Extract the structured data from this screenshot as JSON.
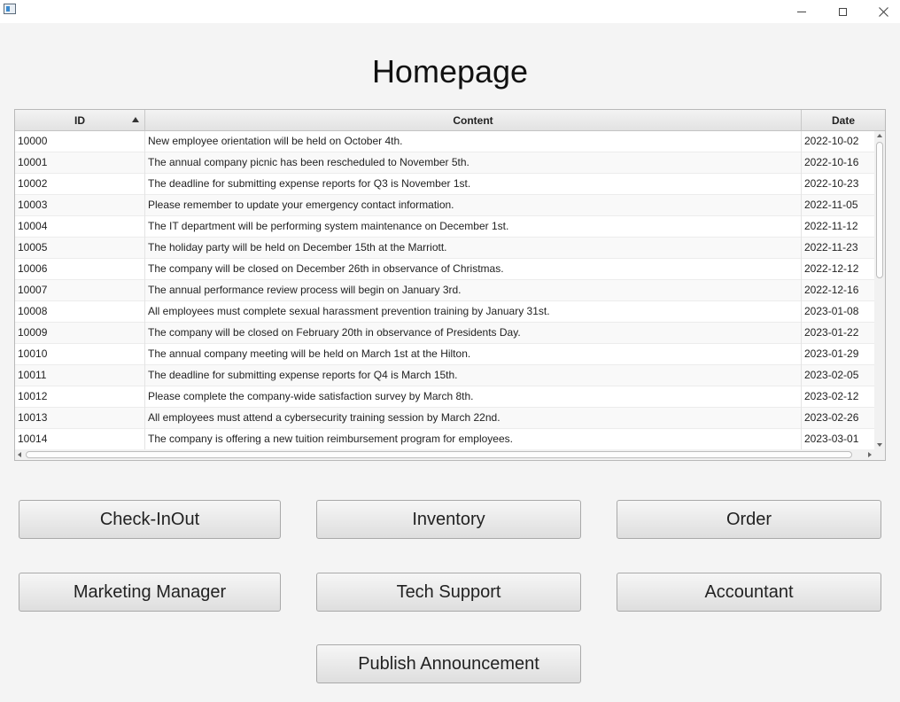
{
  "window": {
    "title": "",
    "controls": [
      "minimize-icon",
      "maximize-icon",
      "close-icon"
    ]
  },
  "page": {
    "title": "Homepage"
  },
  "table": {
    "columns": {
      "id": "ID",
      "content": "Content",
      "date": "Date"
    },
    "sort": {
      "column": "ID",
      "direction": "ascending"
    },
    "rows": [
      {
        "id": "10000",
        "content": "New employee orientation will be held on October 4th.",
        "date": "2022-10-02"
      },
      {
        "id": "10001",
        "content": "The annual company picnic has been rescheduled to November 5th.",
        "date": "2022-10-16"
      },
      {
        "id": "10002",
        "content": "The deadline for submitting expense reports for Q3 is November 1st.",
        "date": "2022-10-23"
      },
      {
        "id": "10003",
        "content": "Please remember to update your emergency contact information.",
        "date": "2022-11-05"
      },
      {
        "id": "10004",
        "content": "The IT department will be performing system maintenance on December 1st.",
        "date": "2022-11-12"
      },
      {
        "id": "10005",
        "content": "The holiday party will be held on December 15th at the Marriott.",
        "date": "2022-11-23"
      },
      {
        "id": "10006",
        "content": "The company will be closed on December 26th in observance of Christmas.",
        "date": "2022-12-12"
      },
      {
        "id": "10007",
        "content": "The annual performance review process will begin on January 3rd.",
        "date": "2022-12-16"
      },
      {
        "id": "10008",
        "content": "All employees must complete sexual harassment prevention training by January 31st.",
        "date": "2023-01-08"
      },
      {
        "id": "10009",
        "content": "The company will be closed on February 20th in observance of Presidents Day.",
        "date": "2023-01-22"
      },
      {
        "id": "10010",
        "content": "The annual company meeting will be held on March 1st at the Hilton.",
        "date": "2023-01-29"
      },
      {
        "id": "10011",
        "content": "The deadline for submitting expense reports for Q4 is March 15th.",
        "date": "2023-02-05"
      },
      {
        "id": "10012",
        "content": "Please complete the company-wide satisfaction survey by March 8th.",
        "date": "2023-02-12"
      },
      {
        "id": "10013",
        "content": "All employees must attend a cybersecurity training session by March 22nd.",
        "date": "2023-02-26"
      },
      {
        "id": "10014",
        "content": "The company is offering a new tuition reimbursement program for employees.",
        "date": "2023-03-01"
      }
    ]
  },
  "buttons": {
    "check_inout": "Check-InOut",
    "inventory": "Inventory",
    "order": "Order",
    "marketing_manager": "Marketing Manager",
    "tech_support": "Tech Support",
    "accountant": "Accountant",
    "publish_announcement": "Publish Announcement"
  }
}
